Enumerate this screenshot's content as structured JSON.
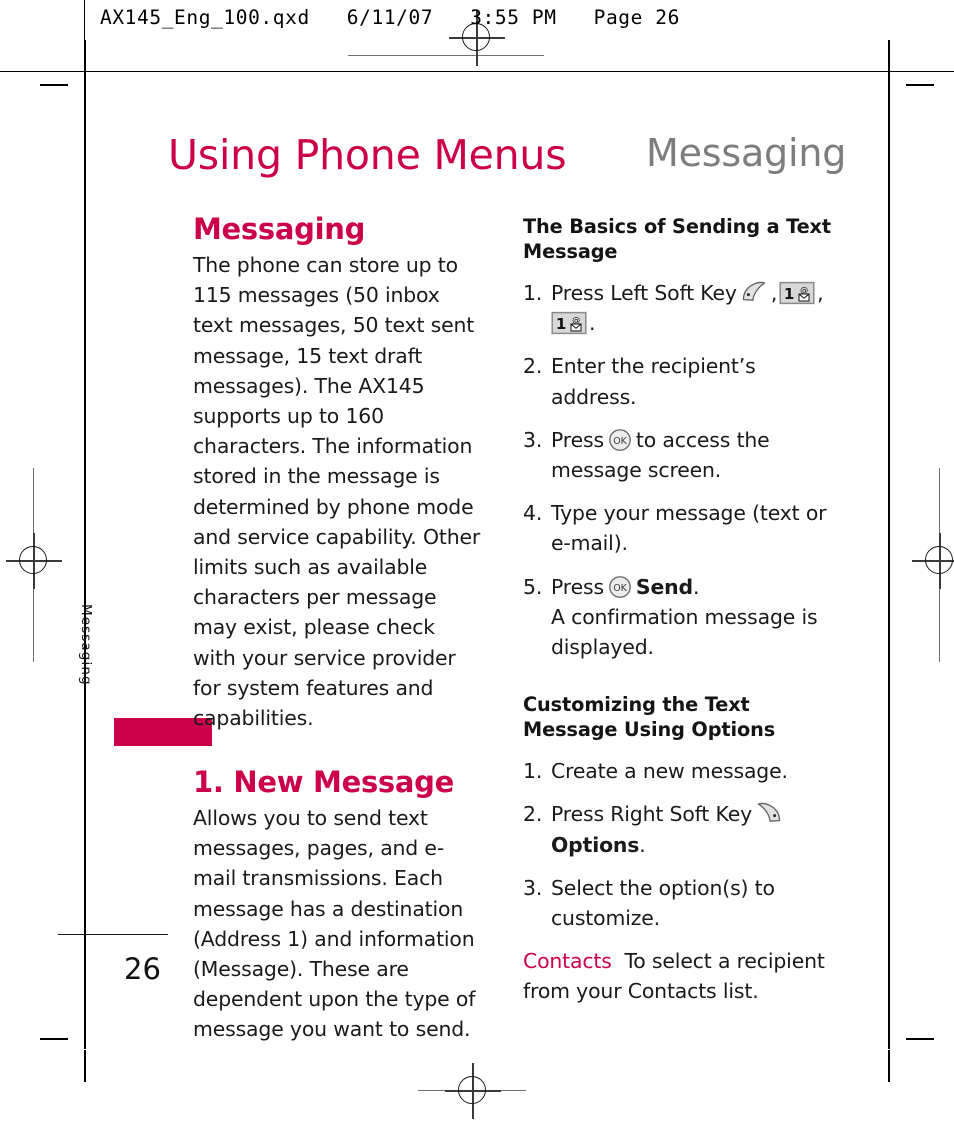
{
  "header": {
    "file_info": "AX145_Eng_100.qxd   6/11/07   3:55 PM   Page 26"
  },
  "running_head": {
    "left": "Using Phone Menus",
    "right": "Messaging"
  },
  "side_tab": {
    "label": "Messaging"
  },
  "colors": {
    "accent": "#CC0049",
    "running_head_right": "#7d7d7d",
    "body_text": "#1a1a1a"
  },
  "left_column": {
    "section_title": "Messaging",
    "section_body": "The phone can store up to 115 messages (50 inbox text messages, 50 text sent message, 15 text draft messages). The AX145 supports up to 160 characters. The information stored in the message is determined by phone mode and service capability. Other limits such as available characters per message may exist, please check with your service provider for system features and capabilities.",
    "subsection_title": "1. New Message",
    "subsection_body": "Allows you to send text messages, pages, and e-mail transmissions. Each message has a destination (Address 1) and information (Message). These are dependent upon the type of message you want to send."
  },
  "right_column": {
    "basics_heading": "The Basics of Sending a Text Message",
    "basics_steps": [
      {
        "num": "1.",
        "pre": "Press Left Soft Key",
        "icons": [
          "left-soft-key-icon",
          "num-1-message-key-icon",
          "num-1-message-key-icon"
        ],
        "text_after_first_icon": ",",
        "text_after_second_icon": ",",
        "text_end": "."
      },
      {
        "num": "2.",
        "text": "Enter the recipient’s address."
      },
      {
        "num": "3.",
        "pre": "Press",
        "icon": "ok-key-icon",
        "post": "to access the message screen."
      },
      {
        "num": "4.",
        "text": "Type your message (text or e-mail)."
      },
      {
        "num": "5.",
        "pre": "Press",
        "icon": "ok-key-icon",
        "bold": "Send",
        "post": ".",
        "extra": "A confirmation message is displayed."
      }
    ],
    "customizing_heading": "Customizing the Text Message Using Options",
    "customizing_steps": [
      {
        "num": "1.",
        "text": "Create a new message."
      },
      {
        "num": "2.",
        "pre": "Press Right Soft Key",
        "icon": "right-soft-key-icon",
        "bold": "Options",
        "post": "."
      },
      {
        "num": "3.",
        "text": "Select the option(s) to customize."
      }
    ],
    "note_term": "Contacts",
    "note_text": "To select a recipient from your Contacts list."
  },
  "footer": {
    "page_number": "26"
  },
  "icon_glyphs": {
    "num_key_digit": "1",
    "num_key_at": "@",
    "ok_key_label": "OK"
  }
}
